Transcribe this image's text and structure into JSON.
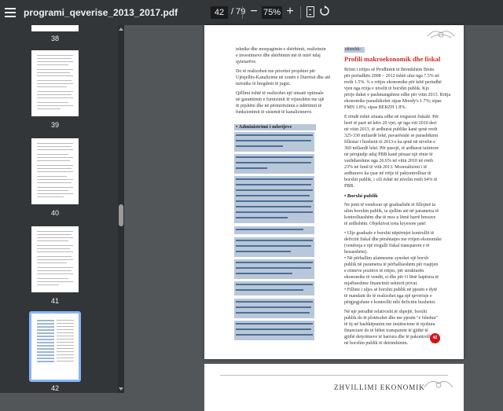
{
  "toolbar": {
    "title": "programi_qeverise_2013_2017.pdf",
    "current_page": "42",
    "total_pages": "/ 79",
    "zoom": "75%",
    "zoom_out": "−",
    "zoom_in": "+"
  },
  "sidebar": {
    "thumbnails": [
      {
        "page": "38"
      },
      {
        "page": "39"
      },
      {
        "page": "40"
      },
      {
        "page": "41"
      },
      {
        "page": "42"
      }
    ],
    "selected_page": "42"
  },
  "document": {
    "left_intro": [
      "teknike dhe mospagimin e shërbimit, realizimin",
      "e investimeve dhe shërbimin më të mirë ndaj",
      "qytetarëve."
    ],
    "left_p2": [
      "Do të realizohen me prioritet projektet për",
      "Ujësjellës-Kanalizime në zonën e Durrësit dhe atë",
      "turistike të bregdetit të jugut."
    ],
    "left_p3": [
      "Qëllimi është të realizohet një situatë optimale",
      "në garantimin e furnizimit të vijueshëm me ujë",
      "të pijshëm dhe në përmirësimin e ndërtimit të",
      "funksionimit të sistemit të kanalizimeve."
    ],
    "left_heading": "• Administrimi i mbetjeve",
    "right_label": "ekteshk:",
    "right_title": "Profili makroekonomik dhe fiskal",
    "right_p1": [
      "Rritni i rritjes së Prodhimit të Brendshëm Bruto",
      "për periudhën 2008 – 2012 është ulur nga 7.5% në",
      "rreth 1.5%. ¾ e rritjes ekonomike për këtë periudhë",
      "vjen nga rritja e nivelit të borxhit publik. Kjo",
      "prirje duket e pashmangshme edhe për vitin 2013. Rritja",
      "ekonomike parashikohet sipas Moody's 1.7%; sipas",
      "FMN 1.8%; sipas BERZH 1.8%."
    ],
    "right_p2": [
      "E rëndë është situata edhe në treguesit fiskalë. Për",
      "herë të parë në këto 20 vjet, që nga viti 2010 deri",
      "në vitin 2013, të ardhurat publike kanë qenë rreth",
      "325-330 miliardë lekë, pavarësisht se parashikimi",
      "fillestar i buxhetit të 2013-s ka qenë në nivelin e",
      "360 miliardë lekë. Për pasojë, të ardhurat tatimore",
      "në përqindje ndaj PBB kanë pësuar një rënie të",
      "vazhdueshme nga 26.6% në vitin 2010 në rreth",
      "23% në fund të vitit 2013. Mosrealizimi i të",
      "ardhurave ka çuar në rritje të paktontrolluar të",
      "borxhit publik, i cili është në nivelin rreth 64% të",
      "PBB."
    ],
    "right_heading": "• Borxhi publik",
    "right_p3": [
      "Ne jemi të vendosur që gradualisht të fillojmë ta",
      "ulim borxhin publik, ta sjellim atë në parametra të",
      "kontrollueshëm dhe të mos u lëmë barrë brezave",
      "të ardhshëm. Objektivat tona kryesore janë:"
    ],
    "right_p4": [
      "• Ulje graduale e borxhit nëpërmjet kontrollit të",
      "deficitit fiskal dhe përshtatjes me rritjen ekonomike",
      "(vendosja e një rregulli fiskal transparent e të",
      "besueshëm).",
      "• Në përballim afatmesme synohet një borxh",
      "publik në parametra të përballueshëm për ruajtjen",
      "e ritmeve pozitive të rritjes, për strukturën",
      "ekonomike të vendit, si dhe për t'i lënë hapësira të",
      "mjaftueshme financimit sektorit privat.",
      "• Fillimi i uljes së borxhit publik në pjesën e dytë",
      "të mandatit do të realizohet nga një qeverisje e",
      "përgjegjshme e kontrollit mbi deficitin buxhetor."
    ],
    "right_p5": [
      "Në një perudhë relativisht të shpejtë, borxhi",
      "publik do të plotësohet dhe me pjesën \"e fshehur\"",
      "të tij në bashkëpunim me institucione të njohura",
      "financiare do të bëhet transparent të gjithë të",
      "gjithë detyrimeve të barrura dhe të pakontrolluara",
      "në borxhin publik të detrimhimin."
    ],
    "page_number": "42",
    "next_page_title": "ZHVILLIMI EKONOMIK"
  },
  "colors": {
    "toolbar": "#323639",
    "viewer_bg": "#525659",
    "highlight": "#b8c7da",
    "title_red": "#cf2d2d",
    "page_badge": "#d0141a",
    "selection": "#8ab4f8"
  }
}
